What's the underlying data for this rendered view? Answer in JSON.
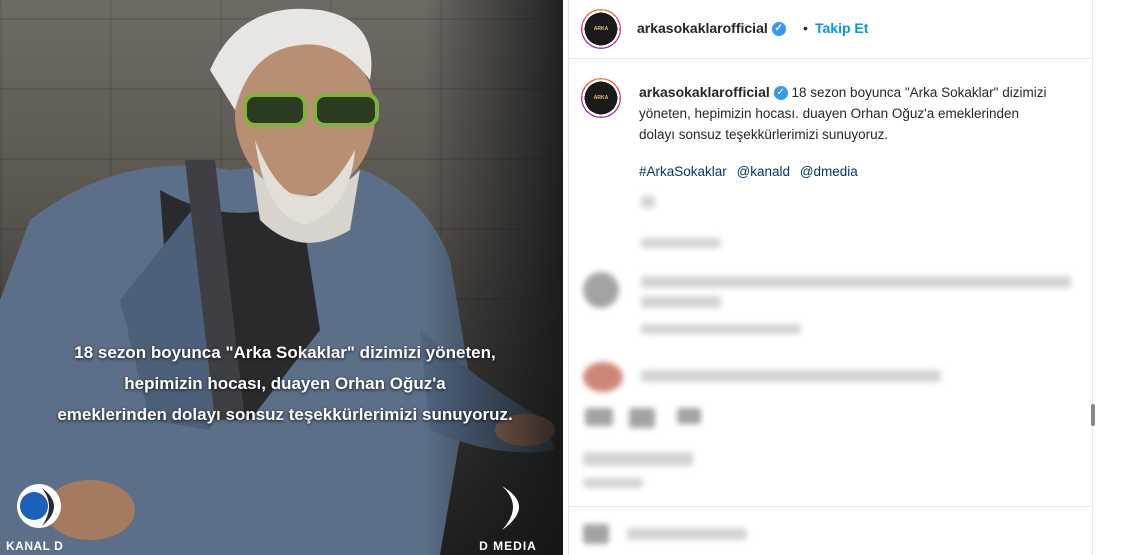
{
  "post": {
    "image_caption_lines": [
      "18 sezon boyunca \"Arka Sokaklar\" dizimizi yöneten,",
      "hepimizin hocası, duayen Orhan Oğuz'a",
      "emeklerinden dolayı sonsuz teşekkürlerimizi sunuyoruz."
    ],
    "logo_left": "KANAL D",
    "logo_right": "D MEDIA"
  },
  "header": {
    "username": "arkasokaklarofficial",
    "separator": "•",
    "follow_label": "Takip Et",
    "verified_icon": "verified-badge-icon"
  },
  "caption": {
    "username": "arkasokaklarofficial",
    "text_line1": "18 sezon boyunca \"Arka Sokaklar\" dizimizi",
    "text_line2": "yöneten, hepimizin hocası. duayen Orhan Oğuz'a emeklerinden",
    "text_line3": "dolayı sonsuz teşekkürlerimizi sunuyoruz.",
    "hashtags": [
      "#ArkaSokaklar",
      "@kanald",
      "@dmedia"
    ]
  },
  "colors": {
    "link": "#00376b",
    "follow": "#0095f6",
    "verified": "#3897f0"
  }
}
